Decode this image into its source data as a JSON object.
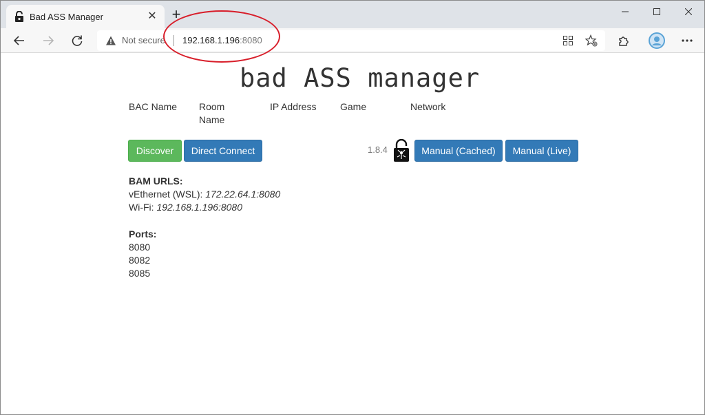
{
  "browser": {
    "tab_title": "Bad ASS Manager",
    "new_tab_label": "+",
    "security_label": "Not secure",
    "url_host": "192.168.1.196",
    "url_port": ":8080"
  },
  "page": {
    "title": "bad ASS manager",
    "columns": [
      "BAC Name",
      "Room\nName",
      "IP Address",
      "Game",
      "Network"
    ],
    "buttons": {
      "discover": "Discover",
      "direct_connect": "Direct Connect",
      "manual_cached": "Manual (Cached)",
      "manual_live": "Manual (Live)"
    },
    "version": "1.8.4",
    "bam_urls": {
      "heading": "BAM URLS:",
      "entries": [
        {
          "label": "vEthernet (WSL): ",
          "value": "172.22.64.1:8080"
        },
        {
          "label": "Wi-Fi: ",
          "value": "192.168.1.196:8080"
        }
      ]
    },
    "ports": {
      "heading": "Ports:",
      "values": [
        "8080",
        "8082",
        "8085"
      ]
    }
  },
  "colors": {
    "annotation": "#d81e2a",
    "green": "#5cb85c",
    "blue": "#337ab7"
  }
}
